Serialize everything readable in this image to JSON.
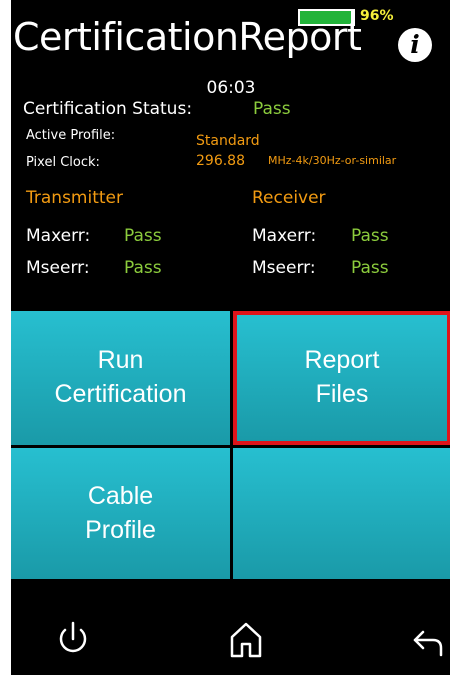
{
  "status_bar": {
    "battery_percent": "96%",
    "battery_level": 0.96,
    "battery_color": "#22b33a"
  },
  "header": {
    "title": "CertificationReport",
    "info_icon": "info-icon",
    "time": "06:03"
  },
  "certification": {
    "status_label": "Certification Status:",
    "status_value": "Pass",
    "profile_label": "Active Profile:",
    "profile_value": "Standard",
    "pixel_clock_label": "Pixel Clock:",
    "pixel_clock_value": "296.88",
    "pixel_clock_unit": "MHz-4k/30Hz-or-similar"
  },
  "transmitter": {
    "title": "Transmitter",
    "maxerr_label": "Maxerr:",
    "maxerr_value": "Pass",
    "mseerr_label": "Mseerr:",
    "mseerr_value": "Pass"
  },
  "receiver": {
    "title": "Receiver",
    "maxerr_label": "Maxerr:",
    "maxerr_value": "Pass",
    "mseerr_label": "Mseerr:",
    "mseerr_value": "Pass"
  },
  "buttons": {
    "run": {
      "line1": "Run",
      "line2": "Certification"
    },
    "report": {
      "line1": "Report",
      "line2": "Files"
    },
    "cable": {
      "line1": "Cable",
      "line2": "Profile"
    }
  },
  "navigation": {
    "power_icon": "power-icon",
    "home_icon": "home-icon",
    "back_icon": "back-arrow-icon"
  },
  "colors": {
    "accent_tile": "#1fb0c0",
    "pass_green": "#8ccc3d",
    "section_orange": "#f29b12",
    "highlight_border": "#e0141a"
  }
}
